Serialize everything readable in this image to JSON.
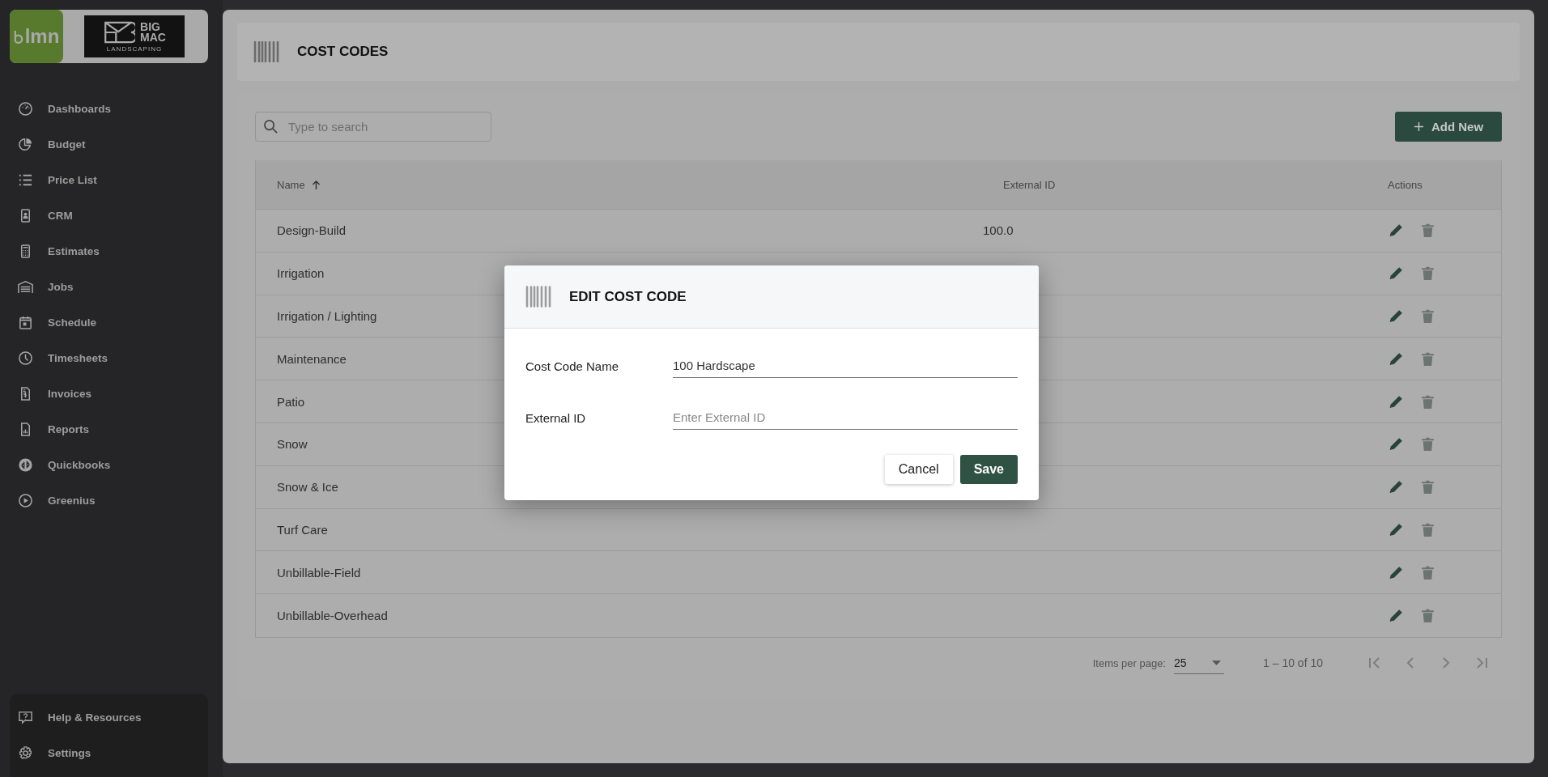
{
  "sidebar": {
    "logo": {
      "app": "lmn",
      "company": [
        "BIG",
        "MAC"
      ],
      "tagline": "LANDSCAPING"
    },
    "items": [
      {
        "label": "Dashboards"
      },
      {
        "label": "Budget"
      },
      {
        "label": "Price List"
      },
      {
        "label": "CRM"
      },
      {
        "label": "Estimates"
      },
      {
        "label": "Jobs"
      },
      {
        "label": "Schedule"
      },
      {
        "label": "Timesheets"
      },
      {
        "label": "Invoices"
      },
      {
        "label": "Reports"
      },
      {
        "label": "Quickbooks"
      },
      {
        "label": "Greenius"
      }
    ],
    "bottom_items": [
      {
        "label": "Help & Resources"
      },
      {
        "label": "Settings"
      }
    ]
  },
  "page": {
    "title": "COST CODES",
    "search": {
      "placeholder": "Type to search"
    },
    "add_button": "Add New"
  },
  "table": {
    "columns": [
      {
        "label": "Name",
        "sorted_ascending": true
      },
      {
        "label": "External ID"
      },
      {
        "label": "Actions"
      }
    ],
    "rows": [
      {
        "name": "Design-Build",
        "external_id": "100.0"
      },
      {
        "name": "Irrigation"
      },
      {
        "name": "Irrigation / Lighting"
      },
      {
        "name": "Maintenance"
      },
      {
        "name": "Patio"
      },
      {
        "name": "Snow"
      },
      {
        "name": "Snow & Ice"
      },
      {
        "name": "Turf Care"
      },
      {
        "name": "Unbillable-Field"
      },
      {
        "name": "Unbillable-Overhead"
      }
    ]
  },
  "pagination": {
    "items_per_page_label": "Items per page:",
    "items_per_page": "25",
    "range": "1 – 10 of 10"
  },
  "dialog": {
    "title": "EDIT COST CODE",
    "fields": [
      {
        "label": "Cost Code Name",
        "value": "100 Hardscape"
      },
      {
        "label": "External ID",
        "placeholder": "Enter External ID"
      }
    ],
    "buttons": [
      {
        "label": "Cancel",
        "kind": "secondary"
      },
      {
        "label": "Save",
        "kind": "primary"
      }
    ]
  }
}
